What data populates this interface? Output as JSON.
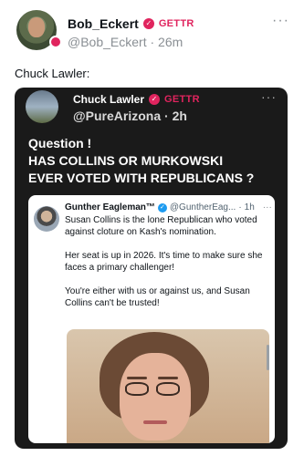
{
  "post": {
    "author_name": "Bob_Eckert",
    "platform_badge": "GETTR",
    "handle": "@Bob_Eckert",
    "time": "26m",
    "more": "···",
    "text": "Chuck Lawler:"
  },
  "quoted_post": {
    "author_name": "Chuck Lawler",
    "platform_badge": "GETTR",
    "handle": "@PureArizona",
    "time": "2h",
    "more": "···",
    "headline_lines": [
      "Question !",
      "HAS COLLINS OR MURKOWSKI",
      "EVER VOTED WITH REPUBLICANS ?"
    ]
  },
  "embedded_tweet": {
    "author_name": "Gunther Eagleman™",
    "handle": "@GuntherEag...",
    "time": "1h",
    "more": "···",
    "paragraphs": [
      "Susan Collins is the lone Republican who voted against cloture on Kash's nomination.",
      "Her seat is up in 2026. It's time to make sure she faces a primary challenger!",
      "You're either with us or against us, and Susan Collins can't be trusted!"
    ]
  },
  "icons": {
    "verified": "verified-badge-icon",
    "more": "more-options-icon"
  },
  "colors": {
    "gettr_red": "#e0245e",
    "twitter_blue": "#1d9bf0",
    "card_dark": "#1a1a1a"
  }
}
